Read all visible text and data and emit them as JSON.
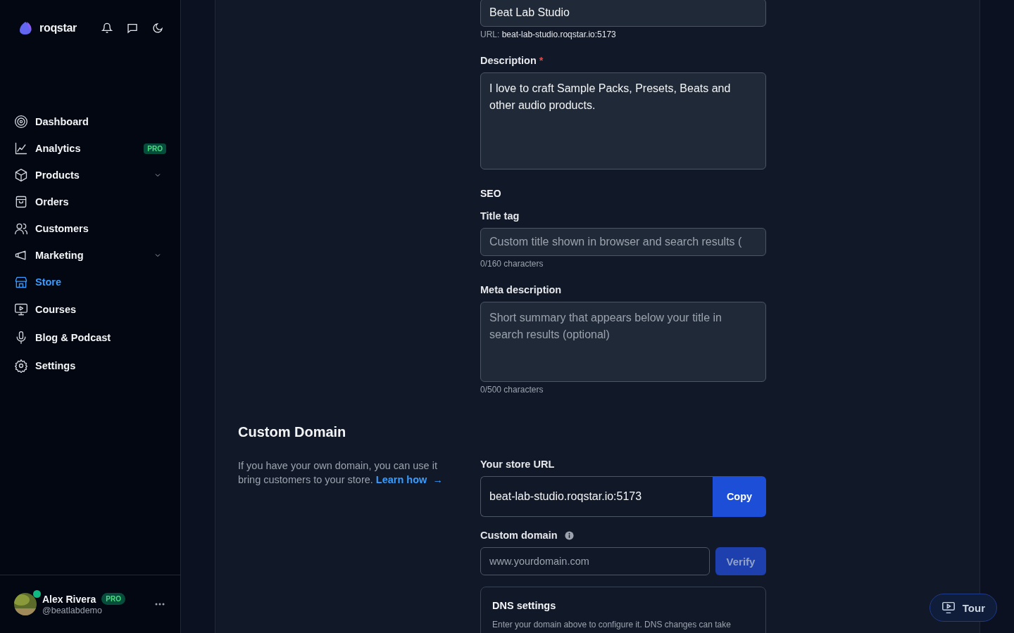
{
  "brand": {
    "name": "roqstar"
  },
  "sidebar": {
    "items": [
      {
        "label": "Dashboard",
        "selected": false
      },
      {
        "label": "Analytics",
        "selected": false,
        "badge": "PRO"
      },
      {
        "label": "Products",
        "selected": false,
        "expandable": true
      },
      {
        "label": "Orders",
        "selected": false
      },
      {
        "label": "Customers",
        "selected": false
      },
      {
        "label": "Marketing",
        "selected": false,
        "expandable": true
      },
      {
        "label": "Store",
        "selected": true
      },
      {
        "label": "Courses",
        "selected": false
      },
      {
        "label": "Blog & Podcast",
        "selected": false
      },
      {
        "label": "Settings",
        "selected": false
      }
    ]
  },
  "user": {
    "name": "Alex Rivera",
    "badge": "PRO",
    "handle": "@beatlabdemo",
    "online": true
  },
  "store_form": {
    "name_value": "Beat Lab Studio",
    "url_label": "URL:",
    "url_value": "beat-lab-studio.roqstar.io:5173",
    "description_label": "Description",
    "required_mark": "*",
    "description_value": "I love to craft Sample Packs, Presets, Beats and other audio products.",
    "seo_heading": "SEO",
    "title_tag_label": "Title tag",
    "title_tag_placeholder": "Custom title shown in browser and search results (",
    "title_tag_count": "0/160 characters",
    "meta_label": "Meta description",
    "meta_placeholder": "Short summary that appears below your title in search results (optional)",
    "meta_count": "0/500 characters"
  },
  "custom_domain": {
    "heading": "Custom Domain",
    "intro": "If you have your own domain, you can use it bring customers to your store.",
    "link": "Learn how",
    "link_arrow": "→",
    "store_url_label": "Your store URL",
    "store_url_value": "beat-lab-studio.roqstar.io:5173",
    "copy_button": "Copy",
    "domain_label": "Custom domain",
    "domain_placeholder": "www.yourdomain.com",
    "verify_button": "Verify",
    "dns_title": "DNS settings",
    "dns_text": "Enter your domain above to configure it. DNS changes can take"
  },
  "tour_button": "Tour"
}
